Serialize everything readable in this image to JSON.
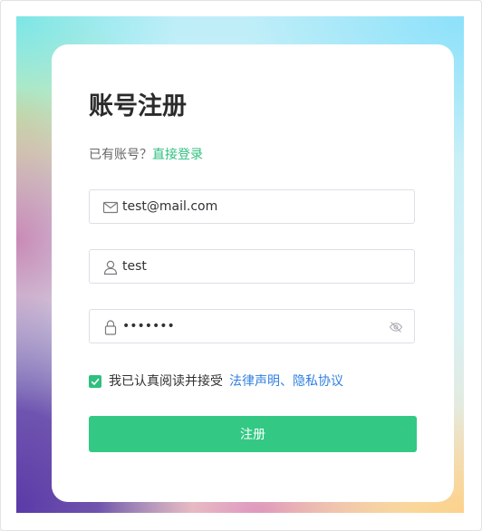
{
  "register": {
    "title": "账号注册",
    "have_account_text": "已有账号？",
    "login_link": "直接登录",
    "email": {
      "value": "test@mail.com",
      "icon": "mail-icon"
    },
    "username": {
      "value": "test",
      "icon": "user-icon"
    },
    "password": {
      "value": "abcdefg",
      "icon": "lock-icon",
      "toggle_icon": "eye-off-icon"
    },
    "agree": {
      "checked": true,
      "text": "我已认真阅读并接受",
      "terms_link": "法律声明、隐私协议"
    },
    "submit_label": "注册"
  },
  "colors": {
    "accent": "#33c984",
    "link_green": "#2fbf7f",
    "link_blue": "#2f7fe0"
  }
}
